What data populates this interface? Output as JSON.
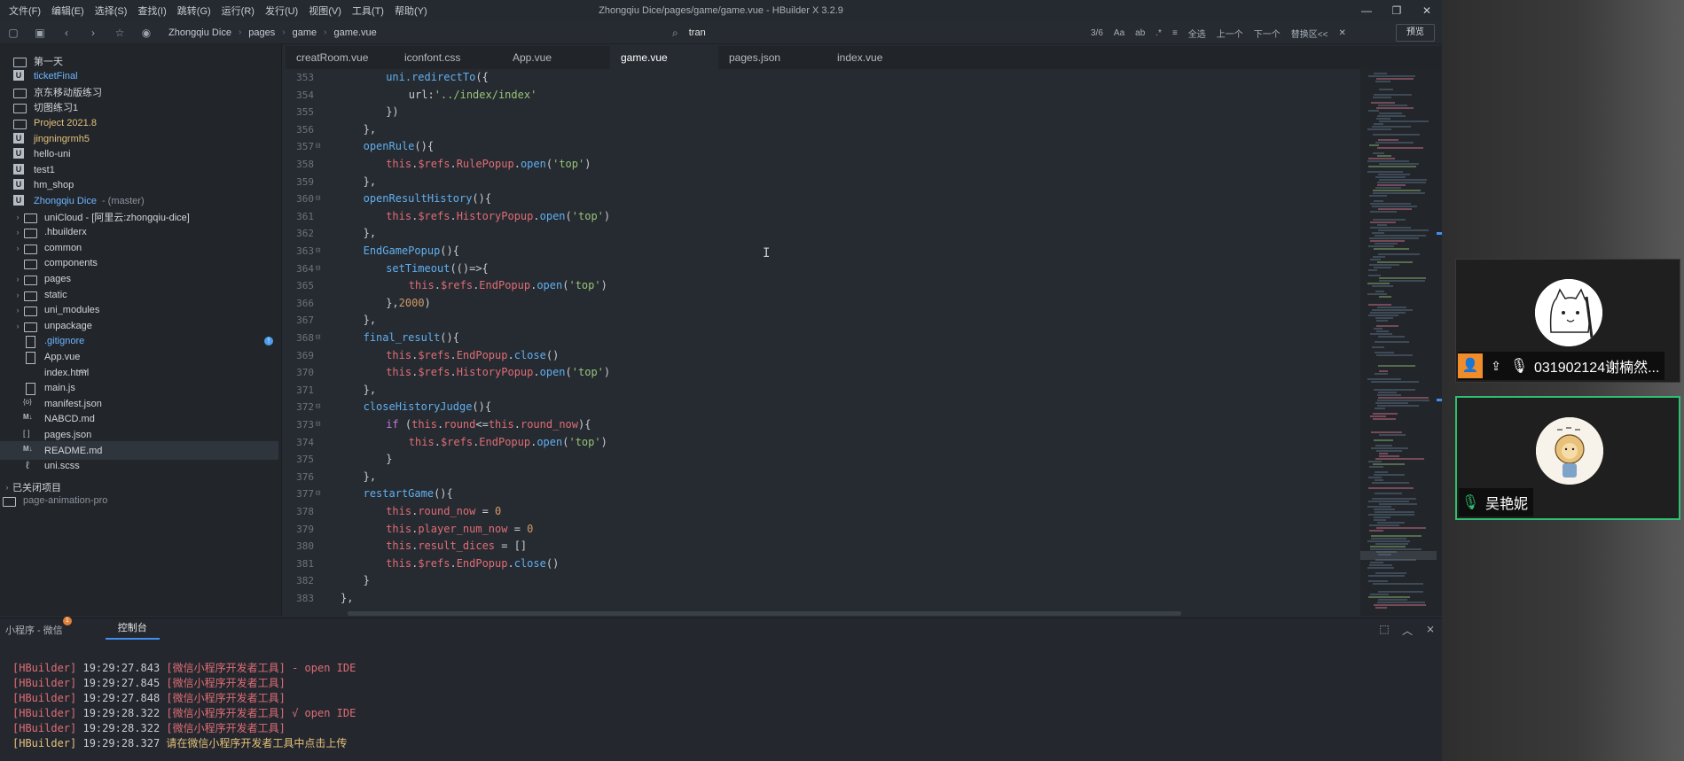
{
  "titlebar": {
    "menus": [
      "文件(F)",
      "编辑(E)",
      "选择(S)",
      "查找(I)",
      "跳转(G)",
      "运行(R)",
      "发行(U)",
      "视图(V)",
      "工具(T)",
      "帮助(Y)"
    ],
    "window_title": "Zhongqiu Dice/pages/game/game.vue - HBuilder X 3.2.9",
    "controls": [
      "—",
      "❐",
      "✕"
    ]
  },
  "toolbar": {
    "breadcrumb": [
      "Zhongqiu Dice",
      "pages",
      "game",
      "game.vue"
    ],
    "search_query": "tran",
    "find": {
      "count": "3/6",
      "select_all": "全选",
      "prev": "上一个",
      "next": "下一个",
      "replace": "替换区<<"
    },
    "preview_label": "预览"
  },
  "sidebar": {
    "items": [
      {
        "label": "第一天",
        "icon": "folder",
        "style": ""
      },
      {
        "label": "ticketFinal",
        "icon": "proj",
        "style": "hl"
      },
      {
        "label": "京东移动版练习",
        "icon": "folder",
        "style": ""
      },
      {
        "label": "切图练习1",
        "icon": "folder",
        "style": ""
      },
      {
        "label": "Project 2021.8",
        "icon": "folder",
        "style": "warn"
      },
      {
        "label": "jingningrmh5",
        "icon": "proj",
        "style": "warn"
      },
      {
        "label": "hello-uni",
        "icon": "proj",
        "style": ""
      },
      {
        "label": "test1",
        "icon": "proj",
        "style": ""
      },
      {
        "label": "hm_shop",
        "icon": "proj",
        "style": ""
      },
      {
        "label": "Zhongqiu Dice",
        "icon": "proj",
        "style": "hl",
        "sub": "- (master)"
      },
      {
        "label": "uniCloud - [阿里云:zhongqiu-dice]",
        "icon": "folder",
        "style": "",
        "indent": 1,
        "arrow": true
      },
      {
        "label": ".hbuilderx",
        "icon": "folder",
        "style": "",
        "indent": 1,
        "arrow": true
      },
      {
        "label": "common",
        "icon": "folder",
        "style": "",
        "indent": 1,
        "arrow": true
      },
      {
        "label": "components",
        "icon": "folder",
        "style": "",
        "indent": 1
      },
      {
        "label": "pages",
        "icon": "folder",
        "style": "",
        "indent": 1,
        "arrow": true
      },
      {
        "label": "static",
        "icon": "folder",
        "style": "",
        "indent": 1,
        "arrow": true
      },
      {
        "label": "uni_modules",
        "icon": "folder",
        "style": "",
        "indent": 1,
        "arrow": true
      },
      {
        "label": "unpackage",
        "icon": "folder",
        "style": "",
        "indent": 1,
        "arrow": true
      },
      {
        "label": ".gitignore",
        "icon": "file",
        "style": "hl",
        "indent": 1,
        "badge": "!"
      },
      {
        "label": "App.vue",
        "icon": "file",
        "style": "",
        "indent": 1
      },
      {
        "label": "index.html",
        "icon": "code",
        "style": "",
        "indent": 1
      },
      {
        "label": "main.js",
        "icon": "file",
        "style": "",
        "indent": 1
      },
      {
        "label": "manifest.json",
        "icon": "cfg",
        "style": "",
        "indent": 1
      },
      {
        "label": "NABCD.md",
        "icon": "md",
        "style": "",
        "indent": 1
      },
      {
        "label": "pages.json",
        "icon": "json",
        "style": "",
        "indent": 1
      },
      {
        "label": "README.md",
        "icon": "md",
        "style": "",
        "indent": 1,
        "selected": true
      },
      {
        "label": "uni.scss",
        "icon": "scss",
        "style": "",
        "indent": 1
      }
    ],
    "closed_projects_label": "已关闭项目",
    "closed_projects": [
      "page-animation-pro"
    ]
  },
  "tabs": [
    {
      "label": "creatRoom.vue",
      "active": false
    },
    {
      "label": "iconfont.css",
      "active": false
    },
    {
      "label": "App.vue",
      "active": false
    },
    {
      "label": "game.vue",
      "active": true
    },
    {
      "label": "pages.json",
      "active": false
    },
    {
      "label": "index.vue",
      "active": false
    }
  ],
  "editor": {
    "lines": [
      {
        "n": "353",
        "fold": "",
        "ind": 2,
        "toks": [
          [
            "fn",
            "uni.redirectTo"
          ],
          [
            "punc",
            "({"
          ]
        ]
      },
      {
        "n": "354",
        "fold": "",
        "ind": 3,
        "toks": [
          [
            "plain",
            "url:"
          ],
          [
            "str",
            "'../index/index'"
          ]
        ]
      },
      {
        "n": "355",
        "fold": "",
        "ind": 2,
        "toks": [
          [
            "punc",
            "})"
          ]
        ]
      },
      {
        "n": "356",
        "fold": "",
        "ind": 1,
        "toks": [
          [
            "punc",
            "},"
          ]
        ]
      },
      {
        "n": "357",
        "fold": "⊟",
        "ind": 1,
        "toks": [
          [
            "fn",
            "openRule"
          ],
          [
            "punc",
            "(){"
          ]
        ]
      },
      {
        "n": "358",
        "fold": "",
        "ind": 2,
        "toks": [
          [
            "key",
            "this"
          ],
          [
            "punc",
            "."
          ],
          [
            "key",
            "$refs"
          ],
          [
            "punc",
            "."
          ],
          [
            "key",
            "RulePopup"
          ],
          [
            "punc",
            "."
          ],
          [
            "fn",
            "open"
          ],
          [
            "punc",
            "("
          ],
          [
            "str",
            "'top'"
          ],
          [
            "punc",
            ")"
          ]
        ]
      },
      {
        "n": "359",
        "fold": "",
        "ind": 1,
        "toks": [
          [
            "punc",
            "},"
          ]
        ]
      },
      {
        "n": "360",
        "fold": "⊟",
        "ind": 1,
        "toks": [
          [
            "fn",
            "openResultHistory"
          ],
          [
            "punc",
            "(){"
          ]
        ]
      },
      {
        "n": "361",
        "fold": "",
        "ind": 2,
        "toks": [
          [
            "key",
            "this"
          ],
          [
            "punc",
            "."
          ],
          [
            "key",
            "$refs"
          ],
          [
            "punc",
            "."
          ],
          [
            "key",
            "HistoryPopup"
          ],
          [
            "punc",
            "."
          ],
          [
            "fn",
            "open"
          ],
          [
            "punc",
            "("
          ],
          [
            "str",
            "'top'"
          ],
          [
            "punc",
            ")"
          ]
        ]
      },
      {
        "n": "362",
        "fold": "",
        "ind": 1,
        "toks": [
          [
            "punc",
            "},"
          ]
        ]
      },
      {
        "n": "363",
        "fold": "⊟",
        "ind": 1,
        "toks": [
          [
            "fn",
            "EndGamePopup"
          ],
          [
            "punc",
            "(){"
          ]
        ]
      },
      {
        "n": "364",
        "fold": "⊟",
        "ind": 2,
        "toks": [
          [
            "fn",
            "setTimeout"
          ],
          [
            "punc",
            "(()=>{"
          ]
        ]
      },
      {
        "n": "365",
        "fold": "",
        "ind": 3,
        "toks": [
          [
            "key",
            "this"
          ],
          [
            "punc",
            "."
          ],
          [
            "key",
            "$refs"
          ],
          [
            "punc",
            "."
          ],
          [
            "key",
            "EndPopup"
          ],
          [
            "punc",
            "."
          ],
          [
            "fn",
            "open"
          ],
          [
            "punc",
            "("
          ],
          [
            "str",
            "'top'"
          ],
          [
            "punc",
            ")"
          ]
        ]
      },
      {
        "n": "366",
        "fold": "",
        "ind": 2,
        "toks": [
          [
            "punc",
            "},"
          ],
          [
            "num",
            "2000"
          ],
          [
            "punc",
            ")"
          ]
        ]
      },
      {
        "n": "367",
        "fold": "",
        "ind": 1,
        "toks": [
          [
            "punc",
            "},"
          ]
        ]
      },
      {
        "n": "368",
        "fold": "⊟",
        "ind": 1,
        "toks": [
          [
            "fn",
            "final_result"
          ],
          [
            "punc",
            "(){"
          ]
        ]
      },
      {
        "n": "369",
        "fold": "",
        "ind": 2,
        "toks": [
          [
            "key",
            "this"
          ],
          [
            "punc",
            "."
          ],
          [
            "key",
            "$refs"
          ],
          [
            "punc",
            "."
          ],
          [
            "key",
            "EndPopup"
          ],
          [
            "punc",
            "."
          ],
          [
            "fn",
            "close"
          ],
          [
            "punc",
            "()"
          ]
        ]
      },
      {
        "n": "370",
        "fold": "",
        "ind": 2,
        "toks": [
          [
            "key",
            "this"
          ],
          [
            "punc",
            "."
          ],
          [
            "key",
            "$refs"
          ],
          [
            "punc",
            "."
          ],
          [
            "key",
            "HistoryPopup"
          ],
          [
            "punc",
            "."
          ],
          [
            "fn",
            "open"
          ],
          [
            "punc",
            "("
          ],
          [
            "str",
            "'top'"
          ],
          [
            "punc",
            ")"
          ]
        ]
      },
      {
        "n": "371",
        "fold": "",
        "ind": 1,
        "toks": [
          [
            "punc",
            "},"
          ]
        ]
      },
      {
        "n": "372",
        "fold": "⊟",
        "ind": 1,
        "toks": [
          [
            "fn",
            "closeHistoryJudge"
          ],
          [
            "punc",
            "(){"
          ]
        ]
      },
      {
        "n": "373",
        "fold": "⊟",
        "ind": 2,
        "toks": [
          [
            "kw",
            "if "
          ],
          [
            "punc",
            "("
          ],
          [
            "key",
            "this"
          ],
          [
            "punc",
            "."
          ],
          [
            "key",
            "round"
          ],
          [
            "punc",
            "<="
          ],
          [
            "key",
            "this"
          ],
          [
            "punc",
            "."
          ],
          [
            "key",
            "round_now"
          ],
          [
            "punc",
            "){"
          ]
        ]
      },
      {
        "n": "374",
        "fold": "",
        "ind": 3,
        "toks": [
          [
            "key",
            "this"
          ],
          [
            "punc",
            "."
          ],
          [
            "key",
            "$refs"
          ],
          [
            "punc",
            "."
          ],
          [
            "key",
            "EndPopup"
          ],
          [
            "punc",
            "."
          ],
          [
            "fn",
            "open"
          ],
          [
            "punc",
            "("
          ],
          [
            "str",
            "'top'"
          ],
          [
            "punc",
            ")"
          ]
        ]
      },
      {
        "n": "375",
        "fold": "",
        "ind": 2,
        "toks": [
          [
            "punc",
            "}"
          ]
        ]
      },
      {
        "n": "376",
        "fold": "",
        "ind": 1,
        "toks": [
          [
            "punc",
            "},"
          ]
        ]
      },
      {
        "n": "377",
        "fold": "⊟",
        "ind": 1,
        "toks": [
          [
            "fn",
            "restartGame"
          ],
          [
            "punc",
            "(){"
          ]
        ]
      },
      {
        "n": "378",
        "fold": "",
        "ind": 2,
        "toks": [
          [
            "key",
            "this"
          ],
          [
            "punc",
            "."
          ],
          [
            "key",
            "round_now"
          ],
          [
            "punc",
            " = "
          ],
          [
            "num",
            "0"
          ]
        ]
      },
      {
        "n": "379",
        "fold": "",
        "ind": 2,
        "toks": [
          [
            "key",
            "this"
          ],
          [
            "punc",
            "."
          ],
          [
            "key",
            "player_num_now"
          ],
          [
            "punc",
            " = "
          ],
          [
            "num",
            "0"
          ]
        ]
      },
      {
        "n": "380",
        "fold": "",
        "ind": 2,
        "toks": [
          [
            "key",
            "this"
          ],
          [
            "punc",
            "."
          ],
          [
            "key",
            "result_dices"
          ],
          [
            "punc",
            " = []"
          ]
        ]
      },
      {
        "n": "381",
        "fold": "",
        "ind": 2,
        "toks": [
          [
            "key",
            "this"
          ],
          [
            "punc",
            "."
          ],
          [
            "key",
            "$refs"
          ],
          [
            "punc",
            "."
          ],
          [
            "key",
            "EndPopup"
          ],
          [
            "punc",
            "."
          ],
          [
            "fn",
            "close"
          ],
          [
            "punc",
            "()"
          ]
        ]
      },
      {
        "n": "382",
        "fold": "",
        "ind": 1,
        "toks": [
          [
            "punc",
            "}"
          ]
        ]
      },
      {
        "n": "383",
        "fold": "",
        "ind": 0,
        "toks": [
          [
            "punc",
            "},"
          ]
        ]
      }
    ]
  },
  "console": {
    "tab_inactive": "小程序 - 微信",
    "tab_inactive_badge": "1",
    "tab_active": "控制台",
    "logs": [
      {
        "src": "[HBuilder]",
        "time": "19:29:27.843",
        "msg": "[微信小程序开发者工具] - open IDE",
        "done": false
      },
      {
        "src": "[HBuilder]",
        "time": "19:29:27.845",
        "msg": "[微信小程序开发者工具]",
        "done": false
      },
      {
        "src": "[HBuilder]",
        "time": "19:29:27.848",
        "msg": "[微信小程序开发者工具]",
        "done": false
      },
      {
        "src": "[HBuilder]",
        "time": "19:29:28.322",
        "msg": "[微信小程序开发者工具] √ open IDE",
        "done": false
      },
      {
        "src": "[HBuilder]",
        "time": "19:29:28.322",
        "msg": "[微信小程序开发者工具]",
        "done": false
      },
      {
        "src": "[HBuilder]",
        "time": "19:29:28.327",
        "msg": "请在微信小程序开发者工具中点击上传",
        "done": true
      }
    ]
  },
  "call": {
    "participants": [
      {
        "name": "031902124谢楠然...",
        "host": true,
        "sharing": true,
        "speaking": false
      },
      {
        "name": "吴艳妮",
        "host": false,
        "sharing": false,
        "speaking": true
      }
    ]
  },
  "colors": {
    "accent": "#3f8ef0",
    "speaking_border": "#2fbf71",
    "host_badge": "#f08c2a"
  }
}
